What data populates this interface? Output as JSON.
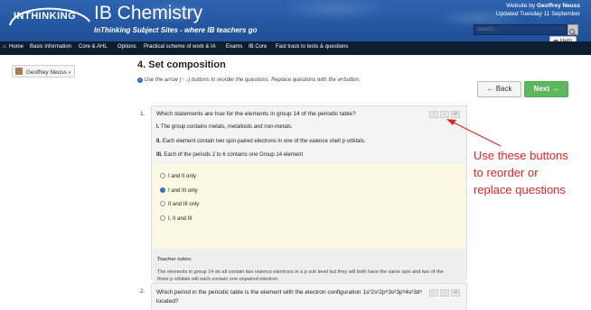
{
  "header": {
    "logo_text": "INTHINKING",
    "title": "IB Chemistry",
    "subtitle": "InThinking Subject Sites - where IB teachers go",
    "website_by_prefix": "Website by ",
    "author": "Geoffrey Neuss",
    "updated": "Updated Tuesday 11 September",
    "search_placeholder": "search...",
    "help_label": "Help"
  },
  "nav": {
    "items": [
      "Home",
      "Basic information",
      "Core & AHL",
      "Options",
      "Practical scheme of work & IA",
      "Exams",
      "IB Core",
      "Fast track to tests & questions"
    ]
  },
  "sidebar": {
    "user_label": "Geoffrey Neuss"
  },
  "main": {
    "heading": "4. Set composition",
    "instructions": "Use the arrow (↑ ↓) buttons to reorder the questions. Replace questions with the ⇄ button.",
    "back_label": "Back",
    "next_label": "Next"
  },
  "questions": [
    {
      "number": "1.",
      "text": "Which statements are true for the elements in group 14 of the periodic table?",
      "statements": [
        {
          "label": "I.",
          "text": "The group contains metals, metalloids and non-metals."
        },
        {
          "label": "II.",
          "text": "Each element contain two spin-paired electrons in one of the valence shell p orbitals."
        },
        {
          "label": "III.",
          "text": "Each of the periods 2 to 6 contains one Group 14 element"
        }
      ],
      "options": [
        "I and II only",
        "I and III only",
        "II and III only",
        "I, II and III"
      ],
      "selected_option": 1,
      "notes_title": "Teacher notes:",
      "notes_lines": [
        "The elements in group 14 do all contain two valence electrons in a p sub level but they will both have the same spin and two of the",
        "three p orbitals will each contain one unpaired electron."
      ]
    },
    {
      "number": "2.",
      "text_line1": "Which period in the periodic table is the element with the electron configuration 1s²2s²2p⁶3s²3p⁶4s²3d⁵",
      "text_line2": "located?"
    }
  ],
  "annotation": {
    "lines": [
      "Use these buttons",
      "to reorder or",
      "replace questions"
    ],
    "color": "#e02424"
  },
  "colors": {
    "header_blue": "#2d63b0",
    "nav_dark": "#0f1d33",
    "next_green": "#5cb85c",
    "selected_radio": "#2b7bd6",
    "options_bg": "#fcf8e3"
  }
}
